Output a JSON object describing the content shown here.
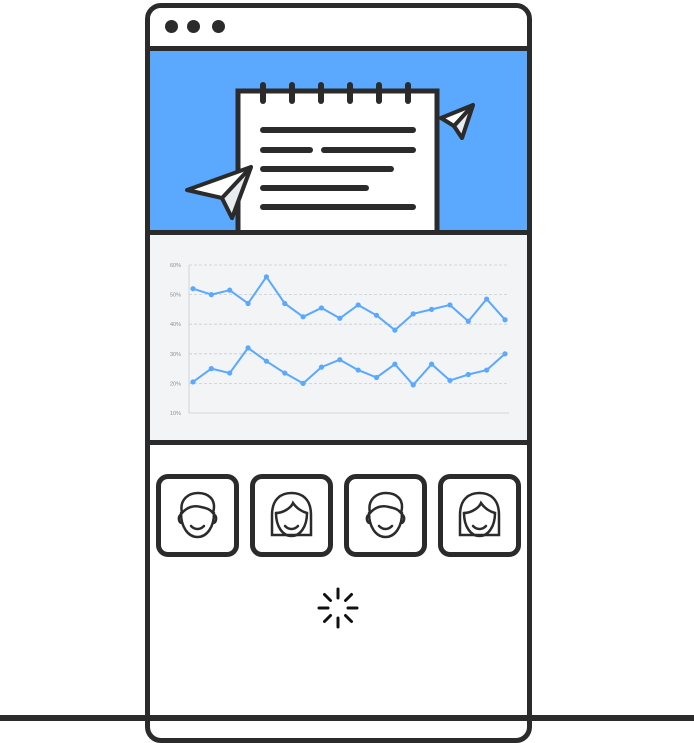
{
  "window": {
    "controls": [
      "window-dot-1",
      "window-dot-2",
      "window-dot-3"
    ]
  },
  "hero": {
    "background_color": "#5aa8ff",
    "illustration": [
      "notepad-icon",
      "paper-plane-icon",
      "paper-plane-icon"
    ]
  },
  "chart_data": {
    "type": "line",
    "y_ticks": [
      "60%",
      "50%",
      "40%",
      "30%",
      "20%",
      "10%"
    ],
    "ylim": [
      10,
      60
    ],
    "grid": true,
    "series": [
      {
        "values": [
          52,
          50,
          51.5,
          47,
          56,
          47,
          42.5,
          45.5,
          42,
          46.5,
          43,
          38,
          43.5,
          45,
          46.5,
          41,
          48.5,
          41.5
        ],
        "color": "#5aa8ff"
      },
      {
        "values": [
          20.5,
          25,
          23.5,
          32,
          27.5,
          23.5,
          20,
          25.5,
          28,
          24.5,
          22,
          26.5,
          19.5,
          26.5,
          21,
          23,
          24.5,
          30
        ],
        "color": "#5aa8ff"
      }
    ]
  },
  "avatars": [
    {
      "icon": "male-avatar-icon"
    },
    {
      "icon": "female-avatar-icon"
    },
    {
      "icon": "male-avatar-icon"
    },
    {
      "icon": "female-avatar-icon"
    }
  ],
  "status": {
    "icon": "loading-spinner-icon"
  }
}
